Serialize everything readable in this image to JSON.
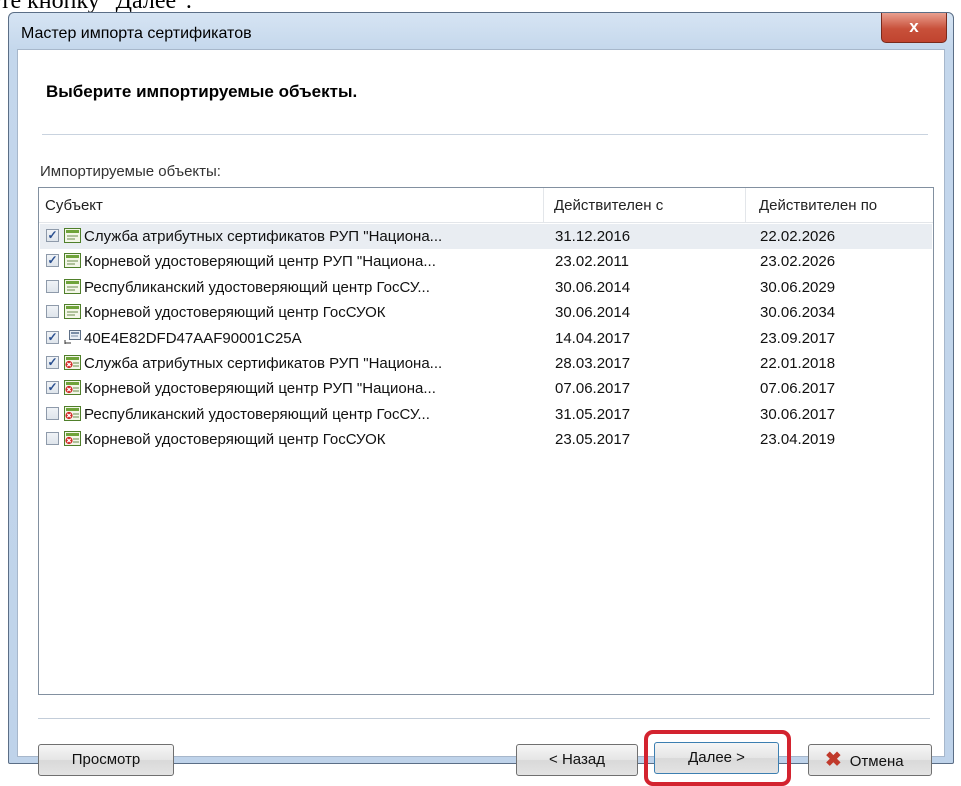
{
  "doc_fragment": "те кнопку \"Далее\".",
  "window": {
    "title": "Мастер импорта сертификатов",
    "close_label": "x"
  },
  "heading": "Выберите импортируемые объекты.",
  "list_label": "Импортируемые объекты:",
  "columns": [
    "Субъект",
    "Действителен с",
    "Действителен по"
  ],
  "rows": [
    {
      "checked": true,
      "icon": "certificate-icon",
      "subject": "Служба атрибутных сертификатов РУП \"Национа...",
      "from": "31.12.2016",
      "to": "22.02.2026",
      "selected": true
    },
    {
      "checked": true,
      "icon": "certificate-icon",
      "subject": "Корневой удостоверяющий центр РУП \"Национа...",
      "from": "23.02.2011",
      "to": "23.02.2026",
      "selected": false
    },
    {
      "checked": false,
      "icon": "certificate-icon",
      "subject": "Республиканский удостоверяющий центр ГосСУ...",
      "from": "30.06.2014",
      "to": "30.06.2029",
      "selected": false
    },
    {
      "checked": false,
      "icon": "certificate-icon",
      "subject": "Корневой удостоверяющий центр ГосСУОК",
      "from": "30.06.2014",
      "to": "30.06.2034",
      "selected": false
    },
    {
      "checked": true,
      "icon": "personal-certificate-icon",
      "subject": "40E4E82DFD47AAF90001C25A",
      "from": "14.04.2017",
      "to": "23.09.2017",
      "selected": false
    },
    {
      "checked": true,
      "icon": "invalid-certificate-icon",
      "subject": "Служба атрибутных сертификатов РУП \"Национа...",
      "from": "28.03.2017",
      "to": "22.01.2018",
      "selected": false
    },
    {
      "checked": true,
      "icon": "invalid-certificate-icon",
      "subject": "Корневой удостоверяющий центр РУП \"Национа...",
      "from": "07.06.2017",
      "to": "07.06.2017",
      "selected": false
    },
    {
      "checked": false,
      "icon": "invalid-certificate-icon",
      "subject": "Республиканский удостоверяющий центр ГосСУ...",
      "from": "31.05.2017",
      "to": "30.06.2017",
      "selected": false
    },
    {
      "checked": false,
      "icon": "invalid-certificate-icon",
      "subject": "Корневой удостоверяющий центр ГосСУОК",
      "from": "23.05.2017",
      "to": "23.04.2019",
      "selected": false
    }
  ],
  "buttons": {
    "view": "Просмотр",
    "back": "< Назад",
    "next": "Далее >",
    "cancel": "Отмена"
  },
  "colors": {
    "highlight": "#d3232f",
    "cancel_icon": "#c0392b"
  }
}
